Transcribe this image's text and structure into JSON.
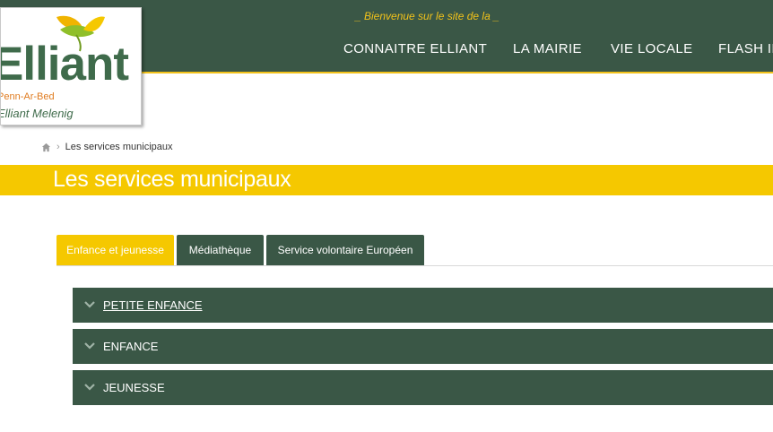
{
  "header": {
    "welcome": "_ Bienvenue sur le site de la _",
    "nav": [
      "CONNAITRE ELLIANT",
      "LA MAIRIE",
      "VIE LOCALE",
      "FLASH IN"
    ]
  },
  "logo": {
    "word": "Elliant",
    "sub1": "Penn-Ar-Bed",
    "sub2": "Elliant Melenig"
  },
  "breadcrumb": {
    "home_icon": "home-icon",
    "current": "Les services municipaux"
  },
  "page": {
    "title": "Les services municipaux"
  },
  "tabs": [
    {
      "label": "Enfance et jeunesse",
      "active": true
    },
    {
      "label": "Médiathèque",
      "active": false
    },
    {
      "label": "Service volontaire Européen",
      "active": false
    }
  ],
  "accordion": [
    {
      "label": "PETITE ENFANCE",
      "icon": "chevron-down-icon"
    },
    {
      "label": "ENFANCE",
      "icon": "chevron-down-icon"
    },
    {
      "label": "JEUNESSE",
      "icon": "chevron-down-icon"
    }
  ],
  "colors": {
    "header_green": "#3a5746",
    "accent_yellow": "#f5c800",
    "welcome_yellow": "#f2c21a"
  }
}
